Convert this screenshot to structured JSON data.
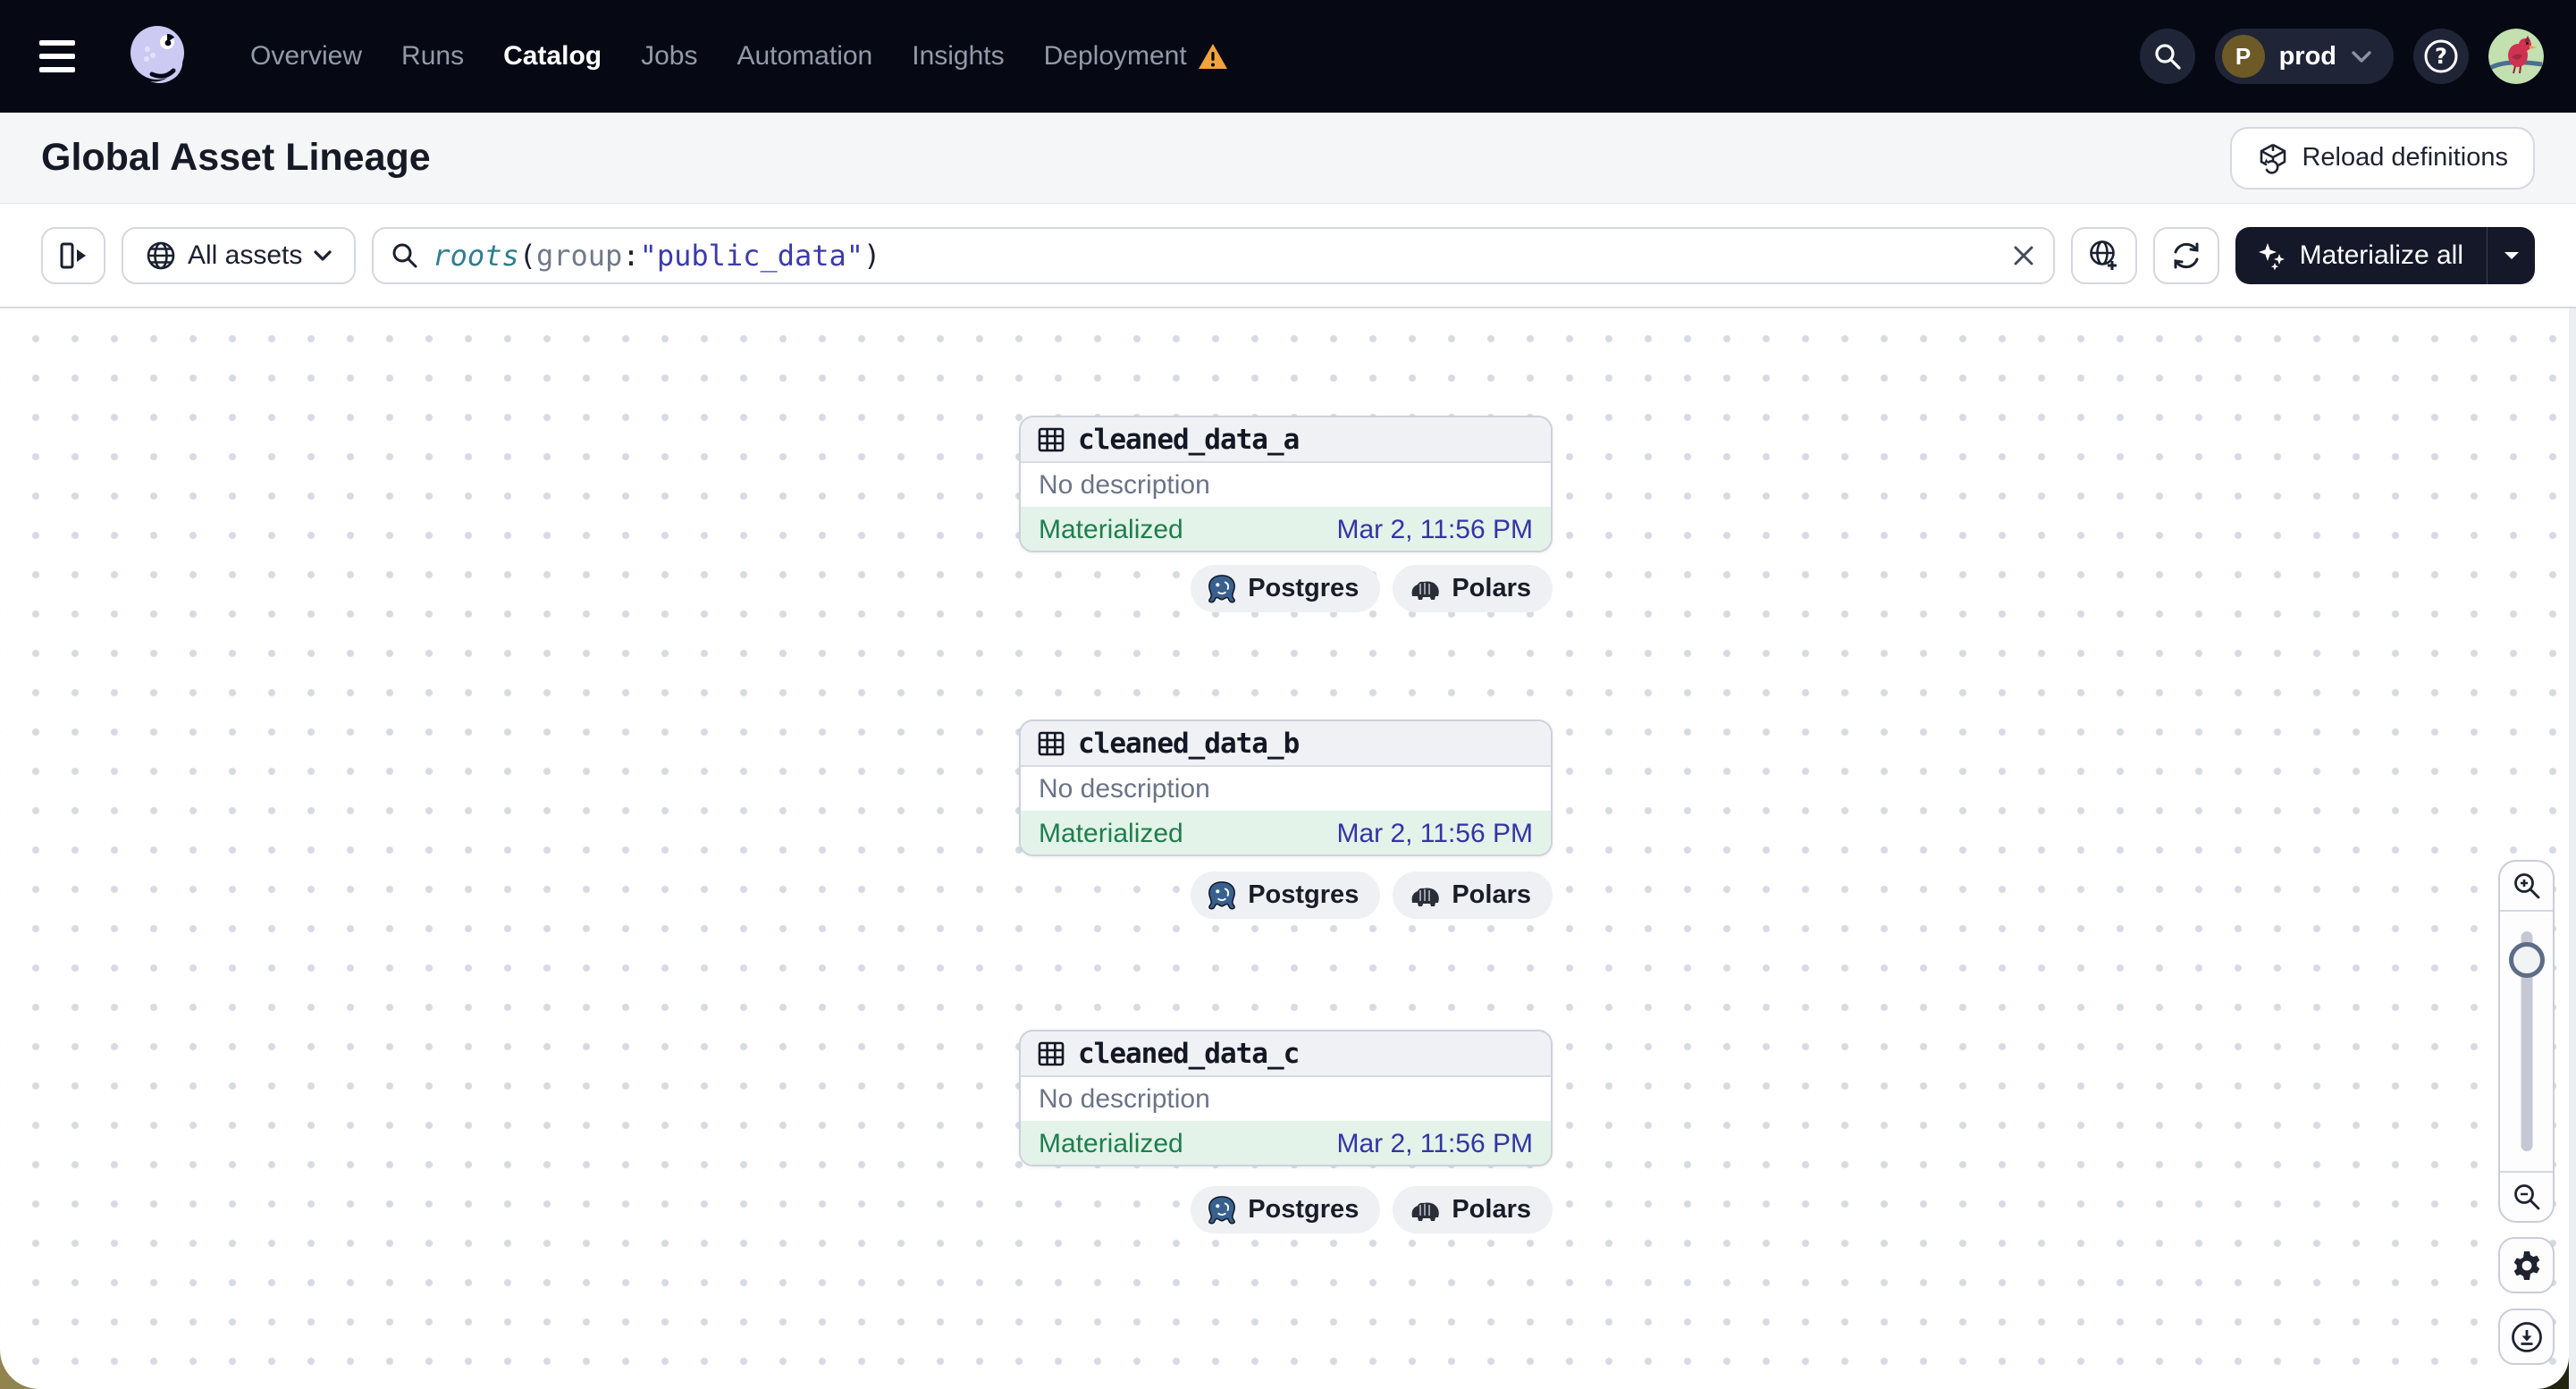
{
  "nav": {
    "items": [
      {
        "label": "Overview",
        "active": false
      },
      {
        "label": "Runs",
        "active": false
      },
      {
        "label": "Catalog",
        "active": true
      },
      {
        "label": "Jobs",
        "active": false
      },
      {
        "label": "Automation",
        "active": false
      },
      {
        "label": "Insights",
        "active": false
      },
      {
        "label": "Deployment",
        "active": false,
        "warning": true
      }
    ],
    "environment": {
      "initial": "P",
      "name": "prod"
    }
  },
  "header": {
    "title": "Global Asset Lineage",
    "reload_button": "Reload definitions"
  },
  "toolbar": {
    "filter_label": "All assets",
    "materialize_label": "Materialize all",
    "query": {
      "function": "roots",
      "open_paren": "(",
      "attribute": "group",
      "colon": ":",
      "value": "\"public_data\"",
      "close_paren": ")"
    }
  },
  "graph": {
    "nodes": [
      {
        "name": "cleaned_data_a",
        "description": "No description",
        "status": "Materialized",
        "timestamp": "Mar 2, 11:56 PM",
        "tags": [
          "Postgres",
          "Polars"
        ]
      },
      {
        "name": "cleaned_data_b",
        "description": "No description",
        "status": "Materialized",
        "timestamp": "Mar 2, 11:56 PM",
        "tags": [
          "Postgres",
          "Polars"
        ]
      },
      {
        "name": "cleaned_data_c",
        "description": "No description",
        "status": "Materialized",
        "timestamp": "Mar 2, 11:56 PM",
        "tags": [
          "Postgres",
          "Polars"
        ]
      }
    ]
  },
  "colors": {
    "nav_bg": "#060914",
    "status_green": "#1e7e4c",
    "status_bg": "#e3f3e9",
    "timestamp_indigo": "#3434a4",
    "warning_orange": "#f2a33c",
    "materialize_bg": "#141829",
    "query_function_teal": "#2f7e8f",
    "query_value_indigo": "#3b3bae"
  }
}
